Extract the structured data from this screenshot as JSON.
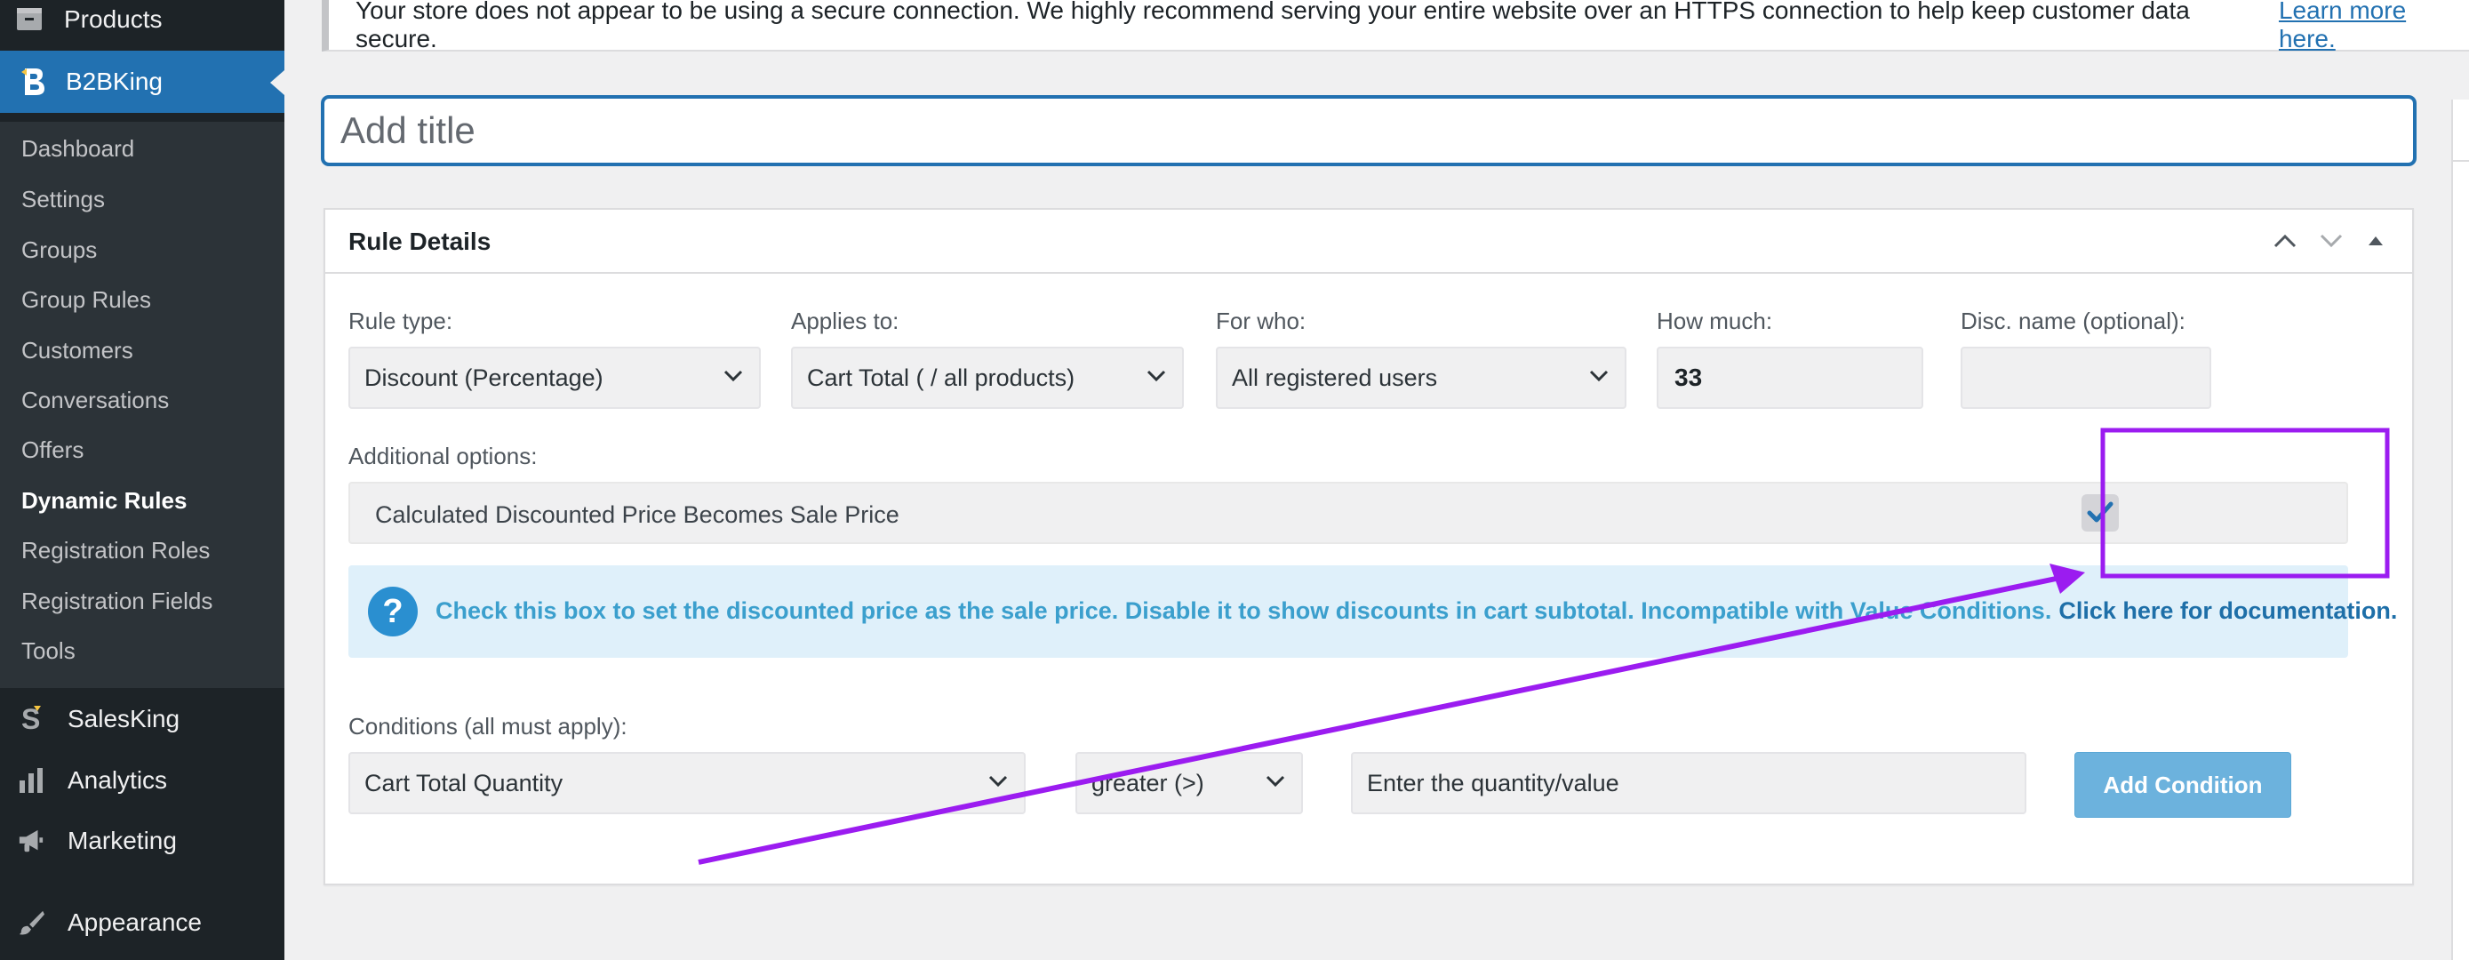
{
  "sidebar": {
    "top_item": {
      "label": "Products",
      "icon": "products-icon"
    },
    "active": {
      "label": "B2BKing",
      "icon": "b2bking-logo-icon"
    },
    "submenu": [
      {
        "label": "Dashboard"
      },
      {
        "label": "Settings"
      },
      {
        "label": "Groups"
      },
      {
        "label": "Group Rules"
      },
      {
        "label": "Customers"
      },
      {
        "label": "Conversations"
      },
      {
        "label": "Offers"
      },
      {
        "label": "Dynamic Rules",
        "current": true
      },
      {
        "label": "Registration Roles"
      },
      {
        "label": "Registration Fields"
      },
      {
        "label": "Tools"
      }
    ],
    "items": [
      {
        "label": "SalesKing",
        "icon": "salesking-icon"
      },
      {
        "label": "Analytics",
        "icon": "analytics-icon"
      },
      {
        "label": "Marketing",
        "icon": "megaphone-icon"
      },
      {
        "label": "Appearance",
        "icon": "brush-icon"
      }
    ]
  },
  "notice": {
    "text": "Your store does not appear to be using a secure connection. We highly recommend serving your entire website over an HTTPS connection to help keep customer data secure.",
    "link": "Learn more here."
  },
  "title_input": {
    "placeholder": "Add title",
    "value": ""
  },
  "panel": {
    "title": "Rule Details",
    "fields": {
      "rule_type": {
        "label": "Rule type:",
        "value": "Discount (Percentage)"
      },
      "applies_to": {
        "label": "Applies to:",
        "value": "Cart Total ( / all products)"
      },
      "for_who": {
        "label": "For who:",
        "value": "All registered users"
      },
      "how_much": {
        "label": "How much:",
        "value": "33"
      },
      "disc_name": {
        "label": "Disc. name (optional):",
        "value": ""
      }
    },
    "additional_options": {
      "label": "Additional options:",
      "option_label": "Calculated Discounted Price Becomes Sale Price",
      "checked": true
    },
    "info": {
      "text": "Check this box to set the discounted price as the sale price. Disable it to show discounts in cart subtotal. Incompatible with Value Conditions.",
      "link": "Click here for documentation."
    },
    "conditions": {
      "label": "Conditions (all must apply):",
      "type_value": "Cart Total Quantity",
      "operator_value": "greater (>)",
      "value_placeholder": "Enter the quantity/value",
      "add_button": "Add Condition"
    }
  },
  "colors": {
    "sidebar_bg": "#1d2327",
    "accent": "#2271b1",
    "annotation": "#9b1cf0",
    "info_text": "#3b9fcd",
    "button": "#6cb2dd"
  }
}
